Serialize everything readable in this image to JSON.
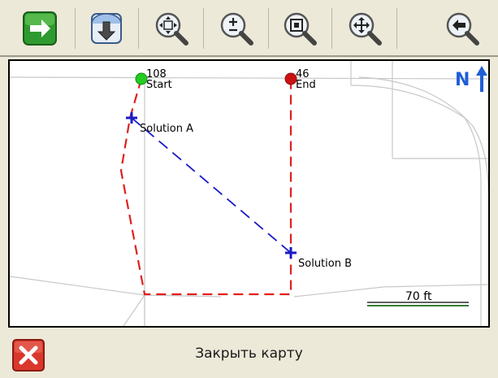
{
  "toolbar": {
    "buttons": [
      {
        "name": "forward-button",
        "icon": "green-arrow-right-icon"
      },
      {
        "name": "download-button",
        "icon": "down-arrow-icon"
      },
      {
        "name": "zoom-fit-button",
        "icon": "zoom-fit-icon"
      },
      {
        "name": "zoom-in-out-button",
        "icon": "zoom-plus-minus-icon"
      },
      {
        "name": "zoom-window-button",
        "icon": "zoom-window-icon"
      },
      {
        "name": "pan-button",
        "icon": "pan-move-icon"
      },
      {
        "name": "back-button",
        "icon": "back-arrow-icon"
      }
    ]
  },
  "map": {
    "north_label": "N",
    "scale_label": "70 ft",
    "points": {
      "start_id": "108",
      "start_label": "Start",
      "end_id": "46",
      "end_label": "End",
      "solution_a_label": "Solution A",
      "solution_b_label": "Solution B"
    },
    "colors": {
      "start": "#22cc22",
      "end": "#cc1111",
      "route": "#e02020",
      "solution": "#1a1ac8",
      "north_arrow": "#1f5fd6"
    }
  },
  "bottom": {
    "close_label": "Закрыть карту"
  }
}
